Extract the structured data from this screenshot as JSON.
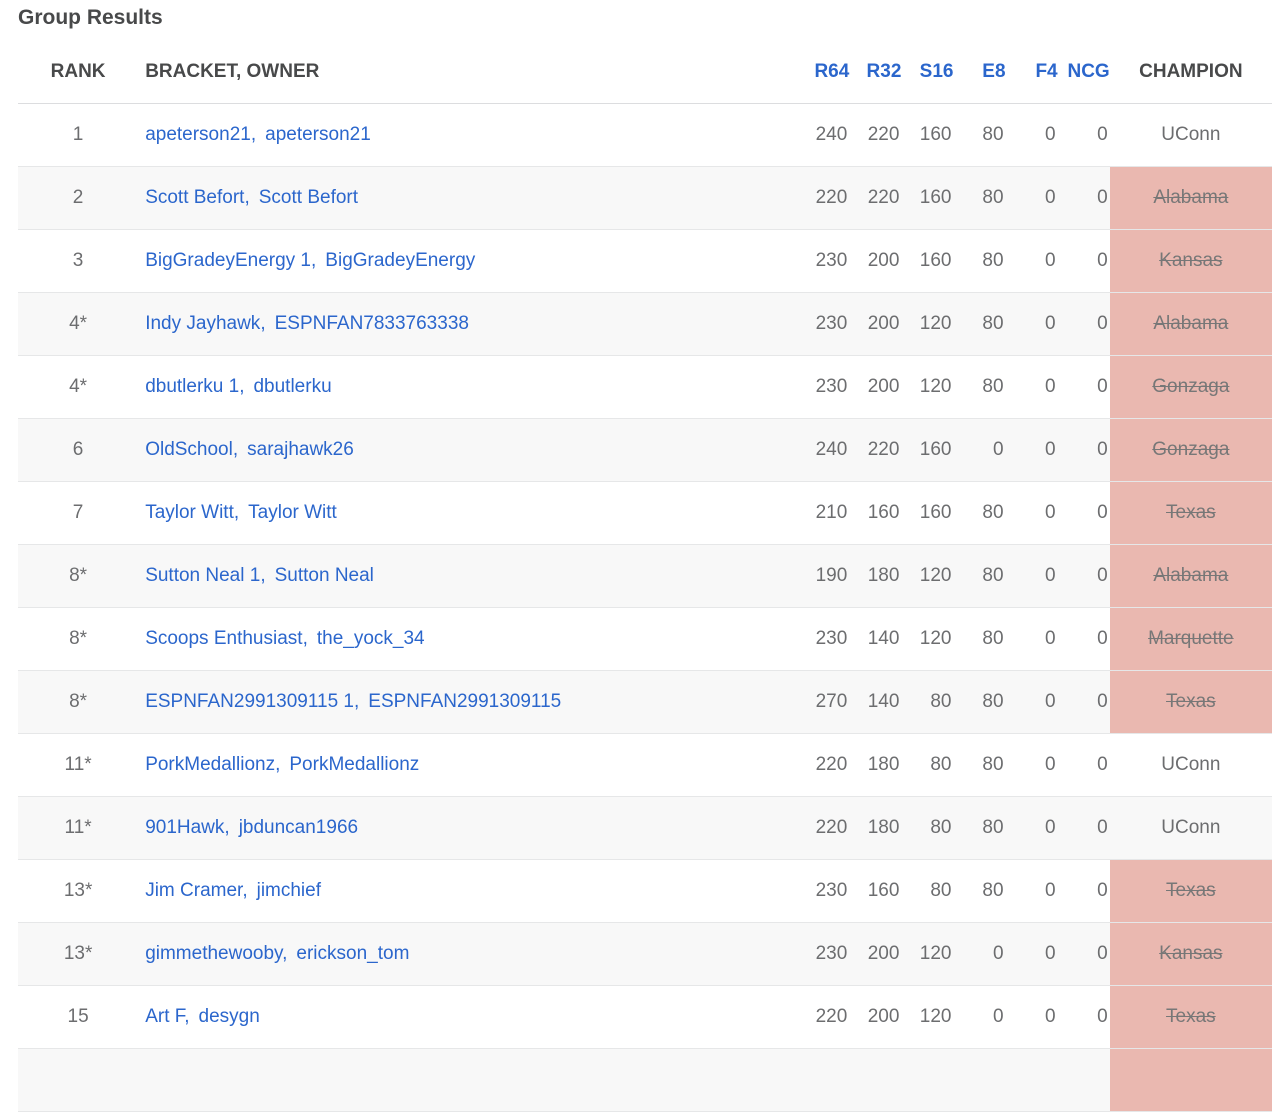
{
  "page_title": "Group Results",
  "columns": {
    "rank": "RANK",
    "bracket_owner": "BRACKET, OWNER",
    "r64": "R64",
    "r32": "R32",
    "s16": "S16",
    "e8": "E8",
    "f4": "F4",
    "ncg": "NCG",
    "champion": "CHAMPION"
  },
  "colors": {
    "link": "#2b66cc",
    "eliminated_bg": "#eab8b0",
    "alt_row_bg": "#f8f8f8"
  },
  "rows": [
    {
      "rank": "1",
      "bracket": "apeterson21",
      "owner": "apeterson21",
      "r64": "240",
      "r32": "220",
      "s16": "160",
      "e8": "80",
      "f4": "0",
      "ncg": "0",
      "champion": "UConn",
      "eliminated": false
    },
    {
      "rank": "2",
      "bracket": "Scott Befort",
      "owner": "Scott Befort",
      "r64": "220",
      "r32": "220",
      "s16": "160",
      "e8": "80",
      "f4": "0",
      "ncg": "0",
      "champion": "Alabama",
      "eliminated": true
    },
    {
      "rank": "3",
      "bracket": "BigGradeyEnergy 1",
      "owner": "BigGradeyEnergy",
      "r64": "230",
      "r32": "200",
      "s16": "160",
      "e8": "80",
      "f4": "0",
      "ncg": "0",
      "champion": "Kansas",
      "eliminated": true
    },
    {
      "rank": "4*",
      "bracket": "Indy Jayhawk",
      "owner": "ESPNFAN7833763338",
      "r64": "230",
      "r32": "200",
      "s16": "120",
      "e8": "80",
      "f4": "0",
      "ncg": "0",
      "champion": "Alabama",
      "eliminated": true
    },
    {
      "rank": "4*",
      "bracket": "dbutlerku 1",
      "owner": "dbutlerku",
      "r64": "230",
      "r32": "200",
      "s16": "120",
      "e8": "80",
      "f4": "0",
      "ncg": "0",
      "champion": "Gonzaga",
      "eliminated": true
    },
    {
      "rank": "6",
      "bracket": "OldSchool",
      "owner": "sarajhawk26",
      "r64": "240",
      "r32": "220",
      "s16": "160",
      "e8": "0",
      "f4": "0",
      "ncg": "0",
      "champion": "Gonzaga",
      "eliminated": true
    },
    {
      "rank": "7",
      "bracket": "Taylor Witt",
      "owner": "Taylor Witt",
      "r64": "210",
      "r32": "160",
      "s16": "160",
      "e8": "80",
      "f4": "0",
      "ncg": "0",
      "champion": "Texas",
      "eliminated": true
    },
    {
      "rank": "8*",
      "bracket": "Sutton Neal 1",
      "owner": "Sutton Neal",
      "r64": "190",
      "r32": "180",
      "s16": "120",
      "e8": "80",
      "f4": "0",
      "ncg": "0",
      "champion": "Alabama",
      "eliminated": true
    },
    {
      "rank": "8*",
      "bracket": "Scoops Enthusiast",
      "owner": "the_yock_34",
      "r64": "230",
      "r32": "140",
      "s16": "120",
      "e8": "80",
      "f4": "0",
      "ncg": "0",
      "champion": "Marquette",
      "eliminated": true
    },
    {
      "rank": "8*",
      "bracket": "ESPNFAN2991309115 1",
      "owner": "ESPNFAN2991309115",
      "r64": "270",
      "r32": "140",
      "s16": "80",
      "e8": "80",
      "f4": "0",
      "ncg": "0",
      "champion": "Texas",
      "eliminated": true
    },
    {
      "rank": "11*",
      "bracket": "PorkMedallionz",
      "owner": "PorkMedallionz",
      "r64": "220",
      "r32": "180",
      "s16": "80",
      "e8": "80",
      "f4": "0",
      "ncg": "0",
      "champion": "UConn",
      "eliminated": false
    },
    {
      "rank": "11*",
      "bracket": "901Hawk",
      "owner": "jbduncan1966",
      "r64": "220",
      "r32": "180",
      "s16": "80",
      "e8": "80",
      "f4": "0",
      "ncg": "0",
      "champion": "UConn",
      "eliminated": false
    },
    {
      "rank": "13*",
      "bracket": "Jim Cramer",
      "owner": "jimchief",
      "r64": "230",
      "r32": "160",
      "s16": "80",
      "e8": "80",
      "f4": "0",
      "ncg": "0",
      "champion": "Texas",
      "eliminated": true
    },
    {
      "rank": "13*",
      "bracket": "gimmethewooby",
      "owner": "erickson_tom",
      "r64": "230",
      "r32": "200",
      "s16": "120",
      "e8": "0",
      "f4": "0",
      "ncg": "0",
      "champion": "Kansas",
      "eliminated": true
    },
    {
      "rank": "15",
      "bracket": "Art F",
      "owner": "desygn",
      "r64": "220",
      "r32": "200",
      "s16": "120",
      "e8": "0",
      "f4": "0",
      "ncg": "0",
      "champion": "Texas",
      "eliminated": true
    },
    {
      "rank": "",
      "bracket": "",
      "owner": "",
      "r64": "",
      "r32": "",
      "s16": "",
      "e8": "",
      "f4": "",
      "ncg": "",
      "champion": "",
      "eliminated": true
    }
  ]
}
